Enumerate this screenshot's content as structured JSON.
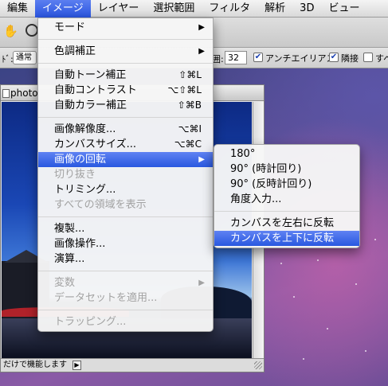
{
  "menubar": {
    "items": [
      {
        "label": "編集"
      },
      {
        "label": "イメージ"
      },
      {
        "label": "レイヤー"
      },
      {
        "label": "選択範囲"
      },
      {
        "label": "フィルタ"
      },
      {
        "label": "解析"
      },
      {
        "label": "3D"
      },
      {
        "label": "ビュー"
      }
    ],
    "active_index": 1
  },
  "options_bar": {
    "mode_prefix": "ﾄﾞ:",
    "mode_value": "通常",
    "tolerance_suffix": "囲:",
    "tolerance_value": "32",
    "antialias_label": "アンチエイリアス",
    "antialias_checked": true,
    "contiguous_label": "隣接",
    "contiguous_checked": true,
    "all_layers_label": "すべ",
    "all_layers_checked": false
  },
  "document": {
    "tab_title": "photo",
    "status_text": "だけで機能します",
    "status_arrow": "▶"
  },
  "image_menu": {
    "items": [
      {
        "label": "モード",
        "shortcut": "",
        "submenu": true,
        "disabled": false
      },
      {
        "sep": true
      },
      {
        "label": "色調補正",
        "shortcut": "",
        "submenu": true,
        "disabled": false
      },
      {
        "sep": true
      },
      {
        "label": "自動トーン補正",
        "shortcut": "⇧⌘L",
        "submenu": false,
        "disabled": false
      },
      {
        "label": "自動コントラスト",
        "shortcut": "⌥⇧⌘L",
        "submenu": false,
        "disabled": false
      },
      {
        "label": "自動カラー補正",
        "shortcut": "⇧⌘B",
        "submenu": false,
        "disabled": false
      },
      {
        "sep": true
      },
      {
        "label": "画像解像度...",
        "shortcut": "⌥⌘I",
        "submenu": false,
        "disabled": false
      },
      {
        "label": "カンバスサイズ...",
        "shortcut": "⌥⌘C",
        "submenu": false,
        "disabled": false
      },
      {
        "label": "画像の回転",
        "shortcut": "",
        "submenu": true,
        "disabled": false,
        "highlighted": true
      },
      {
        "label": "切り抜き",
        "shortcut": "",
        "submenu": false,
        "disabled": true
      },
      {
        "label": "トリミング...",
        "shortcut": "",
        "submenu": false,
        "disabled": false
      },
      {
        "label": "すべての領域を表示",
        "shortcut": "",
        "submenu": false,
        "disabled": true
      },
      {
        "sep": true
      },
      {
        "label": "複製...",
        "shortcut": "",
        "submenu": false,
        "disabled": false
      },
      {
        "label": "画像操作...",
        "shortcut": "",
        "submenu": false,
        "disabled": false
      },
      {
        "label": "演算...",
        "shortcut": "",
        "submenu": false,
        "disabled": false
      },
      {
        "sep": true
      },
      {
        "label": "変数",
        "shortcut": "",
        "submenu": true,
        "disabled": true
      },
      {
        "label": "データセットを適用...",
        "shortcut": "",
        "submenu": false,
        "disabled": true
      },
      {
        "sep": true
      },
      {
        "label": "トラッピング...",
        "shortcut": "",
        "submenu": false,
        "disabled": true
      }
    ]
  },
  "rotate_submenu": {
    "items": [
      {
        "label": "180°",
        "highlighted": false
      },
      {
        "label": "90° (時計回り)",
        "highlighted": false
      },
      {
        "label": "90° (反時計回り)",
        "highlighted": false
      },
      {
        "label": "角度入力...",
        "highlighted": false
      },
      {
        "sep": true
      },
      {
        "label": "カンバスを左右に反転",
        "highlighted": false
      },
      {
        "label": "カンバスを上下に反転",
        "highlighted": true
      }
    ]
  },
  "colors": {
    "highlight": "#2958e0",
    "disabled_text": "#a2a2a2"
  }
}
